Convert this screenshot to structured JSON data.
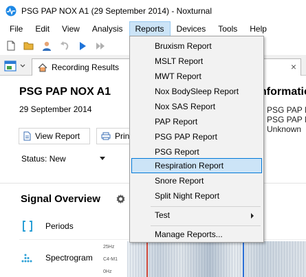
{
  "window": {
    "title": "PSG PAP NOX A1 (29 September 2014)  - Noxturnal"
  },
  "menubar": {
    "items": [
      "File",
      "Edit",
      "View",
      "Analysis",
      "Reports",
      "Devices",
      "Tools",
      "Help"
    ],
    "open_item": "Reports"
  },
  "toolbar": {
    "icons": [
      "new-document-icon",
      "open-folder-icon",
      "user-icon",
      "undo-icon",
      "play-icon",
      "fast-forward-icon"
    ]
  },
  "tab": {
    "label": "Recording Results",
    "close": "×"
  },
  "recording": {
    "title": "PSG PAP NOX A1",
    "date": "29 September 2014",
    "view_report_label": "View Report",
    "print_label": "Print",
    "status_label": "Status: New"
  },
  "info_panel": {
    "title": "nformatio",
    "lines": [
      "PSG PAP N",
      "PSG PAP N",
      "Unknown"
    ]
  },
  "signal_overview": {
    "title": "Signal Overview",
    "rows": [
      {
        "label": "Periods"
      },
      {
        "label": "Spectrogram"
      }
    ],
    "axis_labels": [
      "25Hz",
      "C4-M1",
      "0Hz"
    ]
  },
  "reports_menu": {
    "items": [
      {
        "label": "Bruxism Report"
      },
      {
        "label": "MSLT Report"
      },
      {
        "label": "MWT Report"
      },
      {
        "label": "Nox BodySleep Report"
      },
      {
        "label": "Nox SAS Report"
      },
      {
        "label": "PAP Report"
      },
      {
        "label": "PSG PAP Report"
      },
      {
        "label": "PSG Report"
      },
      {
        "label": "Respiration Report",
        "highlighted": true
      },
      {
        "label": "Snore Report"
      },
      {
        "label": "Split Night Report"
      }
    ],
    "submenu_label": "Test",
    "manage_label": "Manage Reports..."
  },
  "colors": {
    "accent": "#0078d7",
    "highlight": "#cce4f7",
    "menu_bg": "#f2f2f2"
  }
}
